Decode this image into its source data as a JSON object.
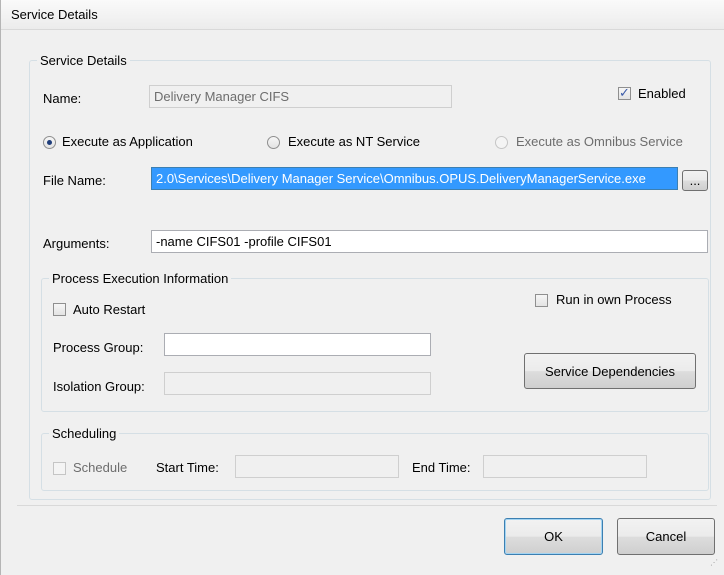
{
  "window": {
    "title": "Service Details"
  },
  "service_details": {
    "legend": "Service Details",
    "name_label": "Name:",
    "name_value": "Delivery Manager CIFS",
    "enabled_label": "Enabled",
    "enabled_checked": true,
    "execute_options": [
      {
        "label": "Execute as Application",
        "selected": true,
        "enabled": true
      },
      {
        "label": "Execute as NT Service",
        "selected": false,
        "enabled": true
      },
      {
        "label": "Execute as Omnibus Service",
        "selected": false,
        "enabled": false
      }
    ],
    "file_name_label": "File Name:",
    "file_name_value": "2.0\\Services\\Delivery Manager Service\\Omnibus.OPUS.DeliveryManagerService.exe",
    "browse_label": "...",
    "arguments_label": "Arguments:",
    "arguments_value": "-name CIFS01 -profile CIFS01"
  },
  "process_execution": {
    "legend": "Process Execution Information",
    "auto_restart_label": "Auto Restart",
    "auto_restart_checked": false,
    "run_own_process_label": "Run in own Process",
    "run_own_process_checked": false,
    "process_group_label": "Process Group:",
    "process_group_value": "",
    "isolation_group_label": "Isolation Group:",
    "isolation_group_value": "",
    "service_dependencies_label": "Service Dependencies"
  },
  "scheduling": {
    "legend": "Scheduling",
    "schedule_label": "Schedule",
    "schedule_checked": false,
    "start_time_label": "Start Time:",
    "start_time_value": "",
    "end_time_label": "End Time:",
    "end_time_value": ""
  },
  "footer": {
    "ok_label": "OK",
    "cancel_label": "Cancel"
  }
}
